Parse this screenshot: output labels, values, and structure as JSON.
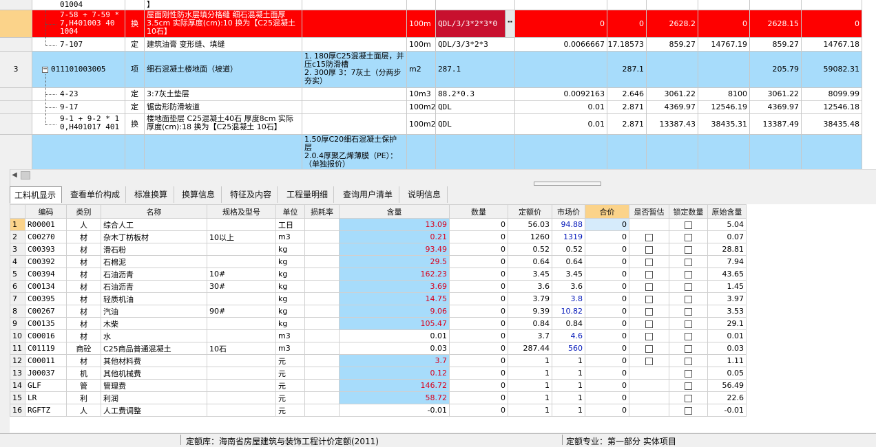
{
  "top_grid": {
    "rows": [
      {
        "num": "",
        "code": "01004",
        "type": "",
        "name": "】",
        "feature": "",
        "unit": "",
        "expr": "",
        "c1": "",
        "c2": "",
        "c3": "",
        "c4": "",
        "c5": "",
        "c6": ""
      },
      {
        "num": "",
        "code": "7-58 + 7-59 * 7,H401003 40 1004",
        "type": "换",
        "name": "屋面刚性防水层填分格缝 细石混凝土面厚3.5cm  实际厚度(cm):10 换为【C25混凝土 10石】",
        "feature": "",
        "unit": "100m",
        "expr": "QDL/3/3*2*3*0",
        "c1": "0",
        "c2": "0",
        "c3": "2628.2",
        "c4": "0",
        "c5": "2628.15",
        "c6": "0"
      },
      {
        "num": "",
        "code": "7-107",
        "type": "定",
        "name": "建筑油膏 变形缝、填缝",
        "feature": "",
        "unit": "100m",
        "expr": "QDL/3/3*2*3",
        "c1": "0.0066667",
        "c2": "17.18573",
        "c3": "859.27",
        "c4": "14767.19",
        "c5": "859.27",
        "c6": "14767.18"
      },
      {
        "num": "3",
        "code": "011101003005",
        "type": "项",
        "name": "细石混凝土楼地面（坡道）",
        "feature": "1. 180厚C25混凝土面层，并压c15防滑槽\n2. 300厚 3：7灰土（分两步夯实）",
        "unit": "m2",
        "expr": "287.1",
        "c1": "",
        "c2": "287.1",
        "c3": "",
        "c4": "",
        "c5": "205.79",
        "c6": "59082.31"
      },
      {
        "num": "",
        "code": "4-23",
        "type": "定",
        "name": "3:7灰土垫层",
        "feature": "",
        "unit": "10m3",
        "expr": "88.2*0.3",
        "c1": "0.0092163",
        "c2": "2.646",
        "c3": "3061.22",
        "c4": "8100",
        "c5": "3061.22",
        "c6": "8099.99"
      },
      {
        "num": "",
        "code": "9-17",
        "type": "定",
        "name": "锯齿形防滑坡道",
        "feature": "",
        "unit": "100m2",
        "expr": "QDL",
        "c1": "0.01",
        "c2": "2.871",
        "c3": "4369.97",
        "c4": "12546.19",
        "c5": "4369.97",
        "c6": "12546.18"
      },
      {
        "num": "",
        "code": "9-1 + 9-2 * 1 0,H401017 401",
        "type": "换",
        "name": "楼地面垫层 C25混凝土40石 厚度8cm  实际厚度(cm):18 换为【C25混凝土 10石】",
        "feature": "",
        "unit": "100m2",
        "expr": "QDL",
        "c1": "0.01",
        "c2": "2.871",
        "c3": "13387.43",
        "c4": "38435.31",
        "c5": "13387.49",
        "c6": "38435.48"
      },
      {
        "num": "",
        "code": "",
        "type": "",
        "name": "",
        "feature": "1.50厚C20细石混凝土保护层\n2.0.4厚聚乙烯薄膜（PE）：（单独报价）",
        "unit": "",
        "expr": "",
        "c1": "",
        "c2": "",
        "c3": "",
        "c4": "",
        "c5": "",
        "c6": ""
      }
    ]
  },
  "tabs": [
    "工料机显示",
    "查看单价构成",
    "标准换算",
    "换算信息",
    "特征及内容",
    "工程量明细",
    "查询用户清单",
    "说明信息"
  ],
  "bottom_grid": {
    "headers": [
      "编码",
      "类别",
      "名称",
      "规格及型号",
      "单位",
      "损耗率",
      "含量",
      "数量",
      "定额价",
      "市场价",
      "合价",
      "是否暂估",
      "锁定数量",
      "原始含量"
    ],
    "rows": [
      {
        "n": "1",
        "code": "R00001",
        "cat": "人",
        "name": "综合人工",
        "spec": "",
        "unit": "工日",
        "loss": "",
        "qty": "13.09",
        "amount": "0",
        "base": "56.03",
        "market": "94.88",
        "total": "0",
        "est": false,
        "lock": true,
        "orig": "5.04",
        "hi": true,
        "mkthi": true
      },
      {
        "n": "2",
        "code": "C00270",
        "cat": "材",
        "name": "杂木丁枋板材",
        "spec": "10以上",
        "unit": "m3",
        "loss": "",
        "qty": "0.21",
        "amount": "0",
        "base": "1260",
        "market": "1319",
        "total": "0",
        "est": true,
        "lock": true,
        "orig": "0.07",
        "hi": true,
        "mkthi": true
      },
      {
        "n": "3",
        "code": "C00393",
        "cat": "材",
        "name": "滑石粉",
        "spec": "",
        "unit": "kg",
        "loss": "",
        "qty": "93.49",
        "amount": "0",
        "base": "0.52",
        "market": "0.52",
        "total": "0",
        "est": true,
        "lock": true,
        "orig": "28.81",
        "hi": true,
        "mkthi": false
      },
      {
        "n": "4",
        "code": "C00392",
        "cat": "材",
        "name": "石棉泥",
        "spec": "",
        "unit": "kg",
        "loss": "",
        "qty": "29.5",
        "amount": "0",
        "base": "0.64",
        "market": "0.64",
        "total": "0",
        "est": true,
        "lock": true,
        "orig": "7.94",
        "hi": true,
        "mkthi": false
      },
      {
        "n": "5",
        "code": "C00394",
        "cat": "材",
        "name": "石油沥青",
        "spec": "10#",
        "unit": "kg",
        "loss": "",
        "qty": "162.23",
        "amount": "0",
        "base": "3.45",
        "market": "3.45",
        "total": "0",
        "est": true,
        "lock": true,
        "orig": "43.65",
        "hi": true,
        "mkthi": false
      },
      {
        "n": "6",
        "code": "C00134",
        "cat": "材",
        "name": "石油沥青",
        "spec": "30#",
        "unit": "kg",
        "loss": "",
        "qty": "3.69",
        "amount": "0",
        "base": "3.6",
        "market": "3.6",
        "total": "0",
        "est": true,
        "lock": true,
        "orig": "1.45",
        "hi": true,
        "mkthi": false
      },
      {
        "n": "7",
        "code": "C00395",
        "cat": "材",
        "name": "轻质机油",
        "spec": "",
        "unit": "kg",
        "loss": "",
        "qty": "14.75",
        "amount": "0",
        "base": "3.79",
        "market": "3.8",
        "total": "0",
        "est": true,
        "lock": true,
        "orig": "3.97",
        "hi": true,
        "mkthi": true
      },
      {
        "n": "8",
        "code": "C00267",
        "cat": "材",
        "name": "汽油",
        "spec": "90#",
        "unit": "kg",
        "loss": "",
        "qty": "9.06",
        "amount": "0",
        "base": "9.39",
        "market": "10.82",
        "total": "0",
        "est": true,
        "lock": true,
        "orig": "3.53",
        "hi": true,
        "mkthi": true
      },
      {
        "n": "9",
        "code": "C00135",
        "cat": "材",
        "name": "木柴",
        "spec": "",
        "unit": "kg",
        "loss": "",
        "qty": "105.47",
        "amount": "0",
        "base": "0.84",
        "market": "0.84",
        "total": "0",
        "est": true,
        "lock": true,
        "orig": "29.1",
        "hi": true,
        "mkthi": false
      },
      {
        "n": "10",
        "code": "C00016",
        "cat": "材",
        "name": "水",
        "spec": "",
        "unit": "m3",
        "loss": "",
        "qty": "0.01",
        "amount": "0",
        "base": "3.7",
        "market": "4.6",
        "total": "0",
        "est": true,
        "lock": true,
        "orig": "0.01",
        "hi": false,
        "mkthi": true
      },
      {
        "n": "11",
        "code": "C01119",
        "cat": "商砼",
        "name": "C25商品普通混凝土",
        "spec": "10石",
        "unit": "m3",
        "loss": "",
        "qty": "0.03",
        "amount": "0",
        "base": "287.44",
        "market": "560",
        "total": "0",
        "est": true,
        "lock": true,
        "orig": "0.03",
        "hi": false,
        "mkthi": true
      },
      {
        "n": "12",
        "code": "C00011",
        "cat": "材",
        "name": "其他材料费",
        "spec": "",
        "unit": "元",
        "loss": "",
        "qty": "3.7",
        "amount": "0",
        "base": "1",
        "market": "1",
        "total": "0",
        "est": true,
        "lock": true,
        "orig": "1.11",
        "hi": true,
        "mkthi": false
      },
      {
        "n": "13",
        "code": "J00037",
        "cat": "机",
        "name": "其他机械费",
        "spec": "",
        "unit": "元",
        "loss": "",
        "qty": "0.12",
        "amount": "0",
        "base": "1",
        "market": "1",
        "total": "0",
        "est": false,
        "lock": true,
        "orig": "0.05",
        "hi": true,
        "mkthi": false
      },
      {
        "n": "14",
        "code": "GLF",
        "cat": "管",
        "name": "管理费",
        "spec": "",
        "unit": "元",
        "loss": "",
        "qty": "146.72",
        "amount": "0",
        "base": "1",
        "market": "1",
        "total": "0",
        "est": false,
        "lock": true,
        "orig": "56.49",
        "hi": true,
        "mkthi": false
      },
      {
        "n": "15",
        "code": "LR",
        "cat": "利",
        "name": "利润",
        "spec": "",
        "unit": "元",
        "loss": "",
        "qty": "58.72",
        "amount": "0",
        "base": "1",
        "market": "1",
        "total": "0",
        "est": false,
        "lock": true,
        "orig": "22.6",
        "hi": true,
        "mkthi": false
      },
      {
        "n": "16",
        "code": "RGFTZ",
        "cat": "人",
        "name": "人工费调整",
        "spec": "",
        "unit": "元",
        "loss": "",
        "qty": "-0.01",
        "amount": "0",
        "base": "1",
        "market": "1",
        "total": "0",
        "est": false,
        "lock": true,
        "orig": "-0.01",
        "hi": false,
        "mkthi": false
      }
    ]
  },
  "status_bar": {
    "quota_lib": "定额库：海南省房屋建筑与装饰工程计价定额(2011)",
    "quota_major": "定额专业：第一部分 实体项目"
  },
  "colors": {
    "red_row": "#fe0000",
    "dark_red": "#c8102e",
    "blue_row": "#a7dcfb",
    "qty_red": "#d9001b",
    "market_blue": "#0015b8",
    "selected": "#fbd38a"
  }
}
